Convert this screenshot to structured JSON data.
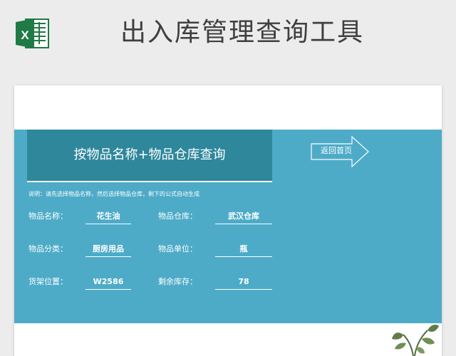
{
  "header": {
    "title": "出入库管理查询工具",
    "icon": "excel-icon"
  },
  "query": {
    "title": "按物品名称+物品仓库查询",
    "back_label": "返回首页",
    "note": "说明：请先选择物品名称，然后选择物品仓库，剩下的公式自动生成"
  },
  "fields": {
    "name_label": "物品名称：",
    "name_value": "花生油",
    "warehouse_label": "物品仓库：",
    "warehouse_value": "武汉仓库",
    "category_label": "物品分类：",
    "category_value": "厨房用品",
    "unit_label": "物品单位：",
    "unit_value": "瓶",
    "shelf_label": "货架位置：",
    "shelf_value": "W2586",
    "stock_label": "剩余库存：",
    "stock_value": "78"
  },
  "colors": {
    "panel": "#4dabc8",
    "title_box": "#2f879b",
    "excel_green": "#1f7a45"
  }
}
